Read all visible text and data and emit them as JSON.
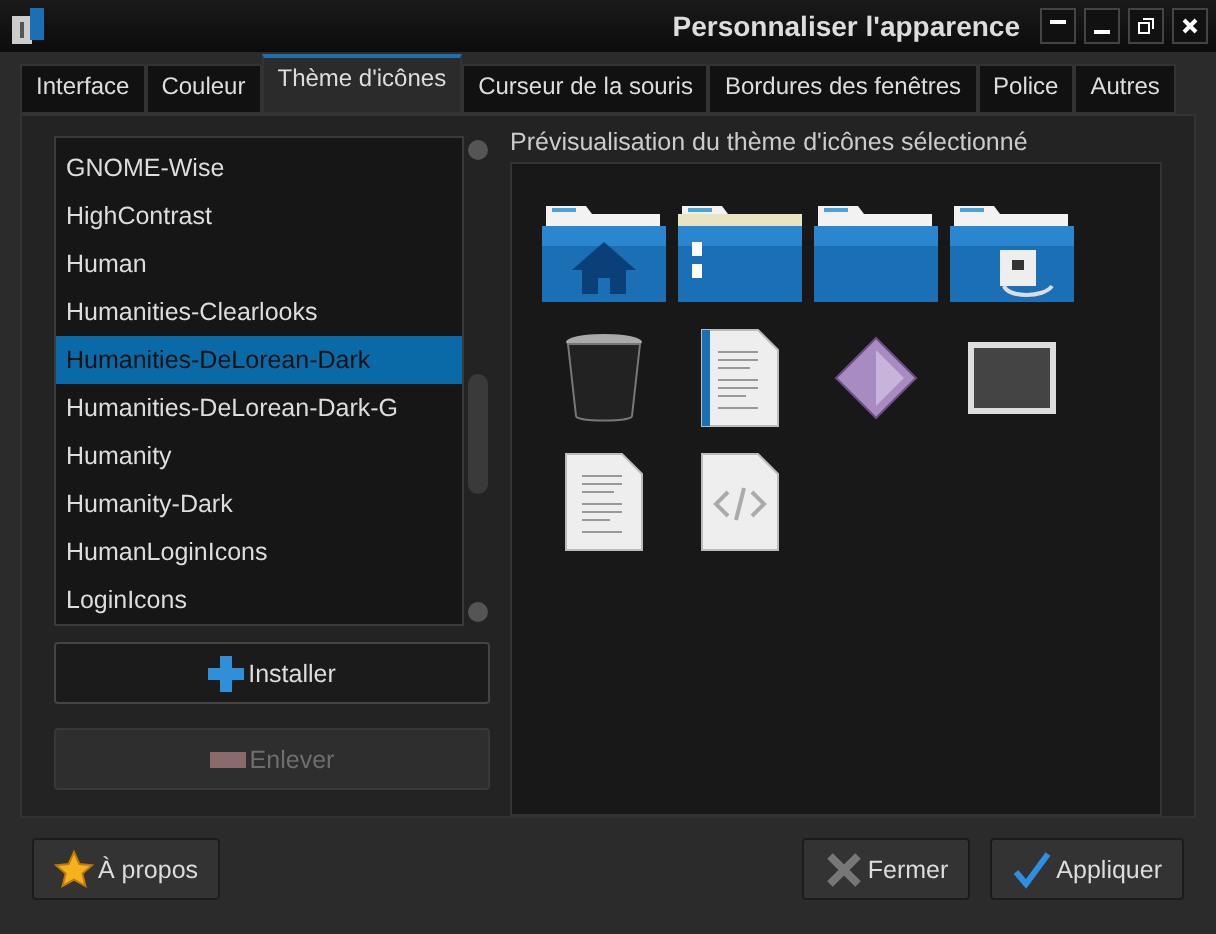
{
  "window": {
    "title": "Personnaliser l'apparence"
  },
  "tabs": [
    {
      "label": "Interface",
      "selected": false
    },
    {
      "label": "Couleur",
      "selected": false
    },
    {
      "label": "Thème d'icônes",
      "selected": true
    },
    {
      "label": "Curseur de la souris",
      "selected": false
    },
    {
      "label": "Bordures des fenêtres",
      "selected": false
    },
    {
      "label": "Police",
      "selected": false
    },
    {
      "label": "Autres",
      "selected": false
    }
  ],
  "theme_list": {
    "items": [
      {
        "label": "GNOME-Wise",
        "selected": false
      },
      {
        "label": "HighContrast",
        "selected": false
      },
      {
        "label": "Human",
        "selected": false
      },
      {
        "label": "Humanities-Clearlooks",
        "selected": false
      },
      {
        "label": "Humanities-DeLorean-Dark",
        "selected": true
      },
      {
        "label": "Humanities-DeLorean-Dark-G",
        "selected": false
      },
      {
        "label": "Humanity",
        "selected": false
      },
      {
        "label": "Humanity-Dark",
        "selected": false
      },
      {
        "label": "HumanLoginIcons",
        "selected": false
      },
      {
        "label": "LoginIcons",
        "selected": false
      }
    ]
  },
  "install_button": {
    "label": "Installer",
    "disabled": false
  },
  "remove_button": {
    "label": "Enlever",
    "disabled": true
  },
  "preview": {
    "title": "Prévisualisation du thème d'icônes sélectionné"
  },
  "footer_buttons": [
    {
      "label": "À propos",
      "kind": "about"
    },
    {
      "label": "Fermer",
      "kind": "close"
    },
    {
      "label": "Appliquer",
      "kind": "apply"
    }
  ]
}
